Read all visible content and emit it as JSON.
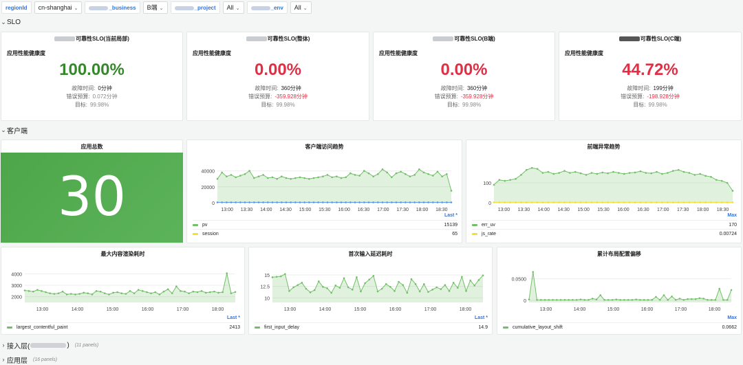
{
  "vars": {
    "regionId_label": "regionId",
    "regionId_value": "cn-shanghai",
    "business_label": "_business",
    "business_value": "B端",
    "project_label": "_project",
    "project_value": "All",
    "env_label": "_env",
    "env_value": "All"
  },
  "rows": {
    "slo": "SLO",
    "client": "客户端",
    "access": "接入层(",
    "access_tail": ")",
    "access_count": "(11 panels)",
    "app": "应用层",
    "app_count": "(16 panels)"
  },
  "slo_panels": [
    {
      "title": "可靠性SLO(当前局部)",
      "subtitle": "应用性能健康度",
      "value": "100.00%",
      "fault_label": "故障时间:",
      "fault": "0分钟",
      "budget_label": "错误预算:",
      "budget": "0.072分钟",
      "target_label": "目标:",
      "target": "99.98%"
    },
    {
      "title": "可靠性SLO(整体)",
      "subtitle": "应用性能健康度",
      "value": "0.00%",
      "fault_label": "故障时间:",
      "fault": "360分钟",
      "budget_label": "错误预算:",
      "budget": "-359.928分钟",
      "target_label": "目标:",
      "target": "99.98%"
    },
    {
      "title": "可靠性SLO(B端)",
      "subtitle": "应用性能健康度",
      "value": "0.00%",
      "fault_label": "故障时间:",
      "fault": "360分钟",
      "budget_label": "错误预算:",
      "budget": "-359.928分钟",
      "target_label": "目标:",
      "target": "99.98%"
    },
    {
      "title": "可靠性SLO(C端)",
      "subtitle": "应用性能健康度",
      "value": "44.72%",
      "fault_label": "故障时间:",
      "fault": "199分钟",
      "budget_label": "错误预算:",
      "budget": "-198.928分钟",
      "target_label": "目标:",
      "target": "99.98%"
    }
  ],
  "app_total": {
    "title": "应用总数",
    "value": "30"
  },
  "colors": {
    "green": "#37872d",
    "red": "#e02f44",
    "pv": "#73bf69",
    "session": "#fade2a",
    "blue": "#3274d9",
    "series_blue": "#5794f2"
  },
  "chart_data": [
    {
      "type": "area",
      "title": "客户端访问趋势",
      "x": [
        "13:00",
        "13:30",
        "14:00",
        "14:30",
        "15:00",
        "15:30",
        "16:00",
        "16:30",
        "17:00",
        "17:30",
        "18:00",
        "18:30"
      ],
      "yticks": [
        "40000",
        "20000",
        "0"
      ],
      "ylim": [
        0,
        50000
      ],
      "legend_header": "Last *",
      "series": [
        {
          "name": "pv",
          "last": "15139",
          "values": [
            30000,
            38000,
            33000,
            35000,
            32000,
            34000,
            36000,
            40000,
            31000,
            33000,
            35000,
            31000,
            32000,
            30000,
            33000,
            31000,
            30000,
            31000,
            32000,
            31000,
            30000,
            31000,
            32000,
            33000,
            35000,
            32000,
            33000,
            31000,
            32000,
            37000,
            35000,
            34000,
            40000,
            37000,
            33000,
            36000,
            42000,
            38000,
            32000,
            37000,
            39000,
            36000,
            33000,
            35000,
            42000,
            38000,
            36000,
            34000,
            39000,
            33000,
            36000,
            15139
          ]
        },
        {
          "name": "session",
          "last": "65",
          "values": [
            500,
            500,
            500,
            500,
            500,
            500,
            500,
            500,
            500,
            500,
            500,
            500,
            500,
            500,
            500,
            500,
            500,
            500,
            500,
            500,
            500,
            500,
            500,
            500,
            500,
            500,
            500,
            500,
            500,
            500,
            500,
            500,
            500,
            500,
            500,
            500,
            500,
            500,
            500,
            500,
            500,
            500,
            500,
            500,
            500,
            500,
            500,
            500,
            500,
            500,
            500,
            500
          ]
        }
      ]
    },
    {
      "type": "area",
      "title": "前端异常趋势",
      "x": [
        "13:00",
        "13:30",
        "14:00",
        "14:30",
        "15:00",
        "15:30",
        "16:00",
        "16:30",
        "17:00",
        "17:30",
        "18:00",
        "18:30"
      ],
      "yticks": [
        "100",
        "0"
      ],
      "ylim": [
        0,
        200
      ],
      "legend_header": "Max",
      "series": [
        {
          "name": "err_uv",
          "last": "170",
          "values": [
            90,
            115,
            110,
            115,
            120,
            140,
            165,
            175,
            170,
            150,
            155,
            145,
            150,
            160,
            150,
            155,
            148,
            140,
            150,
            145,
            152,
            148,
            155,
            150,
            145,
            150,
            152,
            158,
            150,
            148,
            155,
            145,
            150,
            160,
            165,
            155,
            150,
            140,
            145,
            135,
            130,
            115,
            110,
            100,
            60
          ]
        },
        {
          "name": "js_rate",
          "last": "0.00724",
          "values": [
            2,
            2,
            2,
            2,
            2,
            2,
            2,
            2,
            2,
            2,
            2,
            2,
            2,
            2,
            2,
            2,
            2,
            2,
            2,
            2,
            2,
            2,
            2,
            2,
            2,
            2,
            2,
            2,
            2,
            2,
            2,
            2,
            2,
            2,
            2,
            2,
            2,
            2,
            2,
            2,
            2,
            2,
            2,
            2,
            2
          ]
        }
      ]
    },
    {
      "type": "area",
      "title": "最大内容渲染耗时",
      "x": [
        "13:00",
        "14:00",
        "15:00",
        "16:00",
        "17:00",
        "18:00"
      ],
      "yticks": [
        "4000",
        "3000",
        "2000"
      ],
      "ylim": [
        1500,
        4500
      ],
      "legend_header": "Last *",
      "series": [
        {
          "name": "largest_contentful_paint",
          "last": "2413",
          "values": [
            2550,
            2500,
            2450,
            2600,
            2500,
            2400,
            2300,
            2250,
            2300,
            2450,
            2200,
            2250,
            2200,
            2250,
            2350,
            2300,
            2200,
            2500,
            2450,
            2300,
            2200,
            2350,
            2400,
            2300,
            2250,
            2500,
            2300,
            2600,
            2500,
            2400,
            2300,
            2400,
            2200,
            2450,
            2650,
            2300,
            2900,
            2500,
            2450,
            2300,
            2450,
            2400,
            2500,
            2350,
            2400,
            2450,
            2350,
            2400,
            4050,
            2300,
            2413
          ]
        }
      ]
    },
    {
      "type": "area",
      "title": "首次输入延迟耗时",
      "x": [
        "13:00",
        "14:00",
        "15:00",
        "16:00",
        "17:00",
        "18:00"
      ],
      "yticks": [
        "15",
        "12.5",
        "10"
      ],
      "ylim": [
        9,
        16.5
      ],
      "legend_header": "Last *",
      "series": [
        {
          "name": "first_input_delay",
          "last": "14.9",
          "values": [
            14.5,
            14.6,
            14.7,
            15.2,
            11.5,
            12.3,
            12.8,
            13.3,
            12.0,
            11.2,
            11.7,
            13.6,
            12.4,
            12.1,
            11.1,
            12.7,
            12.2,
            14.3,
            12.3,
            11.8,
            14.5,
            11.4,
            13.2,
            14.0,
            14.8,
            11.4,
            12.0,
            13.0,
            12.4,
            11.5,
            13.5,
            12.8,
            11.1,
            14.1,
            13.0,
            11.4,
            13.0,
            11.3,
            11.8,
            12.3,
            11.9,
            12.8,
            11.5,
            13.3,
            12.2,
            14.6,
            11.5,
            13.8,
            12.7,
            13.9,
            14.9
          ]
        }
      ]
    },
    {
      "type": "area",
      "title": "累计布局配置偏移",
      "x": [
        "13:00",
        "14:00",
        "15:00",
        "16:00",
        "17:00",
        "18:00"
      ],
      "yticks": [
        "0.0500",
        "0"
      ],
      "ylim": [
        -0.005,
        0.075
      ],
      "legend_header": "Max",
      "series": [
        {
          "name": "cumulative_layout_shift",
          "last": "0.0662",
          "values": [
            0.002,
            0.066,
            0.001,
            0.001,
            0.001,
            0.001,
            0.001,
            0.001,
            0.001,
            0.001,
            0.001,
            0.001,
            0.001,
            0.002,
            0.001,
            0.001,
            0.004,
            0.002,
            0.012,
            0.001,
            0.001,
            0.001,
            0.002,
            0.001,
            0.001,
            0.001,
            0.001,
            0.002,
            0.001,
            0.001,
            0.001,
            0.001,
            0.008,
            0.001,
            0.012,
            0.001,
            0.009,
            0.001,
            0.004,
            0.001,
            0.003,
            0.003,
            0.003,
            0.005,
            0.004,
            0.001,
            0.001,
            0.001,
            0.027,
            0.001,
            0.001,
            0.024
          ]
        }
      ]
    }
  ]
}
